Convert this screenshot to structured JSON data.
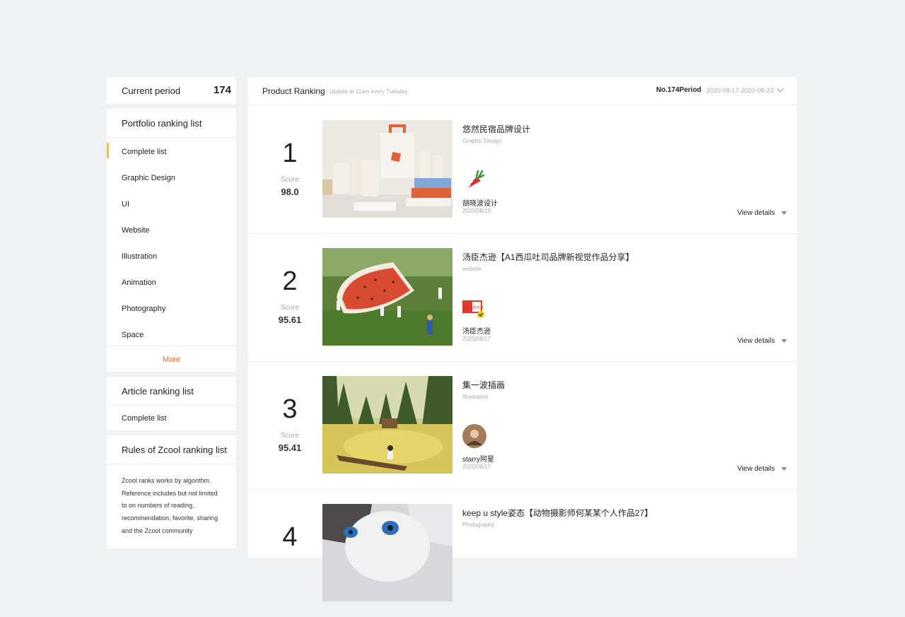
{
  "current_period": {
    "label": "Current period",
    "number": "174"
  },
  "portfolio": {
    "title": "Portfolio ranking list",
    "items": [
      "Complete list",
      "Graphic Design",
      "UI",
      "Website",
      "Illustration",
      "Animation",
      "Photography",
      "Space"
    ],
    "more": "More"
  },
  "article": {
    "title": "Article ranking list",
    "items": [
      "Complete list"
    ]
  },
  "rules": {
    "title": "Rules of Zcool ranking list",
    "text": "Zcool ranks works by algorithm. Reference includes but not limited to on numbers of reading, recommendation, favorite, sharing and the Zcool community"
  },
  "main": {
    "title": "Product Ranking",
    "subtitle": "Update at 11am every Tuesday",
    "period_no": "No.174Period",
    "period_range": "2020-08-17-2020-08-23"
  },
  "colors": {
    "accent": "#f5c518",
    "more": "#e86a1c"
  },
  "rankings": [
    {
      "rank": "1",
      "score_label": "Score",
      "score": "98.0",
      "title": "悠然民宿品牌设计",
      "category": "Graphic Design",
      "author": "胡晓波设计",
      "date": "2020/08/19",
      "details": "View details",
      "avatar_icon": "carrot-icon"
    },
    {
      "rank": "2",
      "score_label": "Score",
      "score": "95.61",
      "title": "汤臣杰逊【A1西瓜吐司品牌新视觉作品分享】",
      "category": "website",
      "author": "汤臣杰逊",
      "date": "2020/08/17",
      "details": "View details",
      "avatar_icon": "brand-logo-icon",
      "avatar_logo_text": "汤臣杰逊"
    },
    {
      "rank": "3",
      "score_label": "Score",
      "score": "95.41",
      "title": "集一波插画",
      "category": "Illustration",
      "author": "starry阿星",
      "date": "2020/08/17",
      "details": "View details",
      "avatar_icon": "user-avatar-icon"
    },
    {
      "rank": "4",
      "title": "keep u style姿态【动物摄影师何某某个人作品27】",
      "category": "Photography"
    }
  ]
}
